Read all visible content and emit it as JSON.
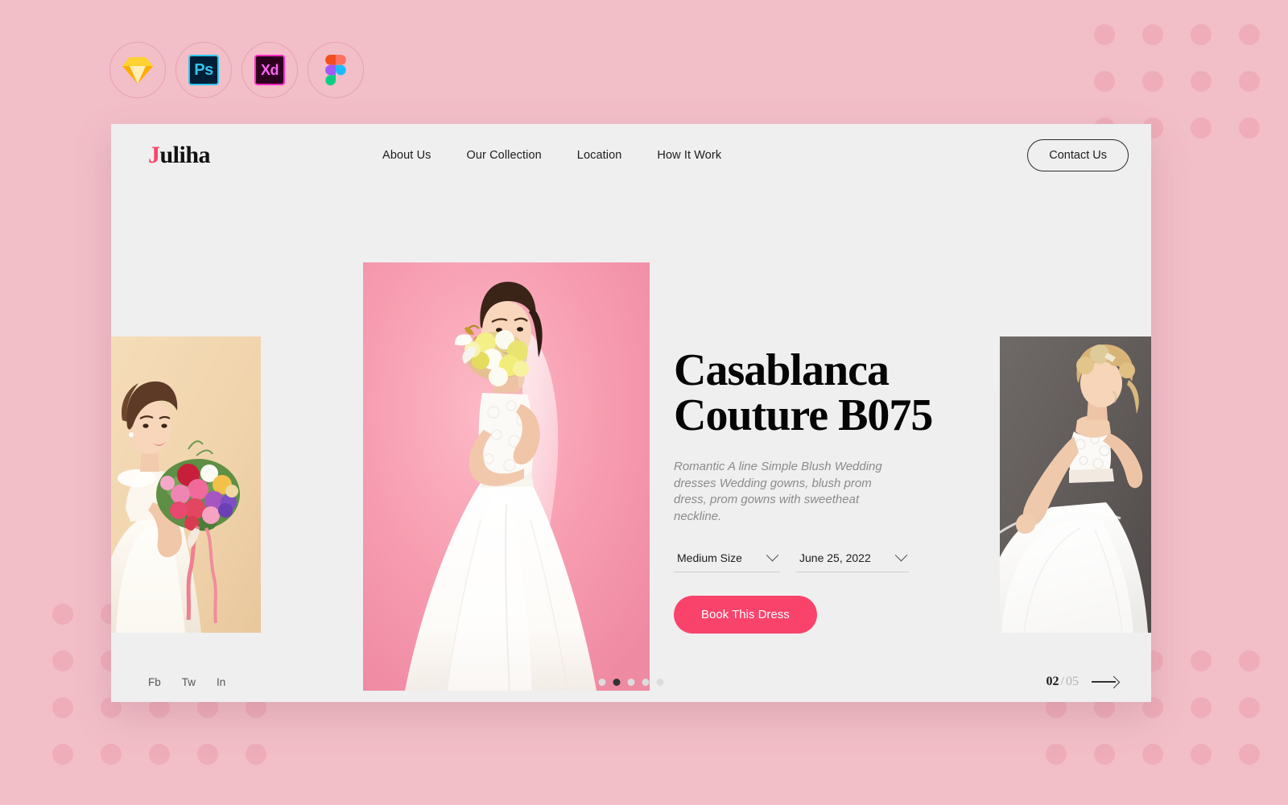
{
  "tool_badges": [
    {
      "name": "sketch",
      "label": ""
    },
    {
      "name": "photoshop",
      "label": "Ps"
    },
    {
      "name": "adobe-xd",
      "label": "Xd"
    },
    {
      "name": "figma",
      "label": ""
    }
  ],
  "header": {
    "logo_first": "J",
    "logo_rest": "uliha",
    "nav": [
      {
        "label": "About Us"
      },
      {
        "label": "Our Collection"
      },
      {
        "label": "Location"
      },
      {
        "label": "How It Work"
      }
    ],
    "contact_label": "Contact Us"
  },
  "hero": {
    "title": "Casablanca\nCouture B075",
    "description": "Romantic A line Simple Blush Wedding dresses Wedding gowns, blush prom dress, prom gowns with sweetheat neckline.",
    "size_selector": {
      "value": "Medium Size",
      "placeholder": "Select Size"
    },
    "date_selector": {
      "value": "June 25, 2022",
      "placeholder": "Select Date"
    },
    "book_label": "Book This Dress",
    "photos": [
      {
        "name": "bride-with-bouquet",
        "alt": "Bride holding colorful bouquet on cream background"
      },
      {
        "name": "bride-with-yellow-flowers",
        "alt": "Bride in lace gown with yellow flowers on pink background"
      },
      {
        "name": "bride-tulle-gown",
        "alt": "Blonde bride in strapless tulle ball gown on grey background"
      }
    ]
  },
  "footer": {
    "social": [
      {
        "label": "Fb"
      },
      {
        "label": "Tw"
      },
      {
        "label": "In"
      }
    ],
    "dots_total": 5,
    "dots_active_index": 1,
    "current_slide": "02",
    "separator": "/",
    "total_slides": "05"
  },
  "colors": {
    "page_background": "#f2bec8",
    "dot_pattern": "#eeadb9",
    "card_background": "#efefef",
    "accent_pink": "#f9436b",
    "text_dark": "#1c1c1c",
    "text_muted": "#8b8b8b"
  }
}
